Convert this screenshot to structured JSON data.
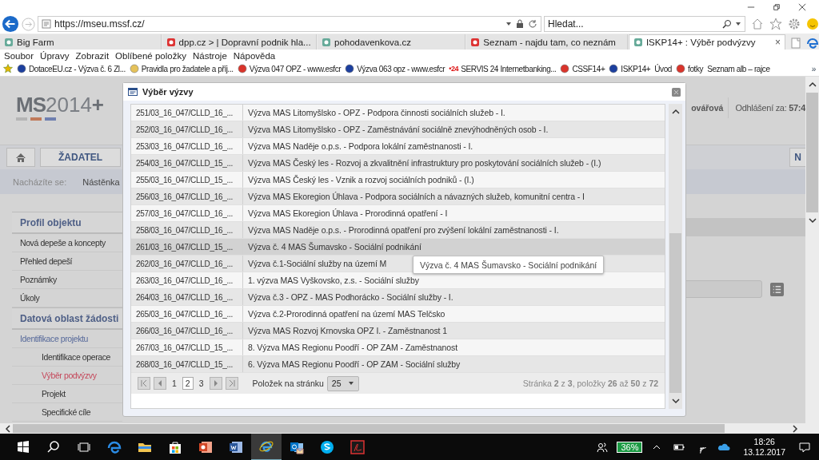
{
  "browser": {
    "url": "https://mseu.mssf.cz/",
    "search": {
      "placeholder": "Hledat..."
    },
    "tabs": [
      {
        "label": "Big Farm",
        "selected": false
      },
      {
        "label": "dpp.cz > | Dopravní podnik hla...",
        "selected": false
      },
      {
        "label": "pohodavenkova.cz",
        "selected": false
      },
      {
        "label": "Seznam - najdu tam, co neznám",
        "selected": false
      },
      {
        "label": "ISKP14+ : Výběr podvýzvy",
        "selected": true,
        "close": "×"
      }
    ],
    "menu": [
      "Soubor",
      "Úpravy",
      "Zobrazit",
      "Oblíbené položky",
      "Nástroje",
      "Nápověda"
    ],
    "favorites": [
      {
        "label": "DotaceEU.cz - Výzva č. 6 Zl..."
      },
      {
        "label": "Pravidla pro žadatele a příj..."
      },
      {
        "label": "Výzva 047 OPZ - www.esfcr"
      },
      {
        "label": "Výzva 063 opz - www.esfcr"
      },
      {
        "label": "SERVIS 24 Internetbanking...",
        "badge": "•24"
      },
      {
        "label": "CSSF14+"
      },
      {
        "label": "ISKP14+"
      },
      {
        "label": "Úvod",
        "kind": "text"
      },
      {
        "label": "fotky"
      },
      {
        "label": "Seznam alb – rajce",
        "kind": "text"
      }
    ],
    "more": "»"
  },
  "page": {
    "logo": {
      "bold": "MS",
      "rest": "2014",
      "plus": "+"
    },
    "user": "ovářová",
    "logout": "Odhlášení za: **57:4**",
    "nav": {
      "role": "ŽADATEL",
      "right": "N"
    },
    "breadcrumb": {
      "label": "Nacházíte se:",
      "current": "Nástěnka"
    },
    "sidebar": [
      {
        "title": "Profil objektu",
        "items": [
          {
            "label": "Nová depeše a koncepty",
            "selected": false
          },
          {
            "label": "Přehled depeší",
            "selected": false
          },
          {
            "label": "Poznámky",
            "selected": false
          },
          {
            "label": "Úkoly",
            "selected": false
          }
        ]
      },
      {
        "title": "Datová oblast žádosti",
        "items": [
          {
            "label": "Identifikace projektu",
            "selected": false,
            "expanded": true,
            "children": [
              {
                "label": "Identifikace operace",
                "selected": false
              },
              {
                "label": "Výběr podvýzvy",
                "selected": true
              },
              {
                "label": "Projekt",
                "selected": false
              },
              {
                "label": "Specifické cíle",
                "selected": false
              }
            ]
          }
        ]
      }
    ]
  },
  "dialog": {
    "title": "Výběr výzvy",
    "rows": [
      {
        "code": "251/03_16_047/CLLD_16_...",
        "name": "Výzva MAS Litomyšlsko - OPZ - Podpora činnosti sociálních služeb - I.",
        "hovered": false
      },
      {
        "code": "252/03_16_047/CLLD_16_...",
        "name": "Výzva MAS Litomyšlsko - OPZ - Zaměstnávání sociálně znevýhodněných osob - I.",
        "hovered": false
      },
      {
        "code": "253/03_16_047/CLLD_16_...",
        "name": "Výzva MAS Naděje o.p.s. - Podpora lokální zaměstnanosti - I.",
        "hovered": false
      },
      {
        "code": "254/03_16_047/CLLD_15_...",
        "name": "Výzva MAS Český les - Rozvoj a zkvalitnění infrastruktury pro poskytování sociálních služeb - (I.)",
        "hovered": false
      },
      {
        "code": "255/03_16_047/CLLD_15_...",
        "name": "Výzva MAS Český les - Vznik a rozvoj sociálních podniků - (I.)",
        "hovered": false
      },
      {
        "code": "256/03_16_047/CLLD_16_...",
        "name": "Výzva MAS Ekoregion Úhlava - Podpora sociálních a návazných služeb, komunitní centra - I",
        "hovered": false
      },
      {
        "code": "257/03_16_047/CLLD_16_...",
        "name": "Výzva MAS Ekoregion Úhlava - Prorodinná opatření - I",
        "hovered": false
      },
      {
        "code": "258/03_16_047/CLLD_16_...",
        "name": "Výzva MAS Naděje o.p.s. - Prorodinná opatření pro zvýšení lokální zaměstnanosti - I.",
        "hovered": false
      },
      {
        "code": "261/03_16_047/CLLD_15_...",
        "name": "Výzva č. 4 MAS Šumavsko - Sociální podnikání",
        "hovered": true
      },
      {
        "code": "262/03_16_047/CLLD_16_...",
        "name": "Výzva č.1-Sociální služby na území M",
        "hovered": false
      },
      {
        "code": "263/03_16_047/CLLD_16_...",
        "name": "1. výzva MAS Vyškovsko, z.s. - Sociální služby",
        "hovered": false
      },
      {
        "code": "264/03_16_047/CLLD_16_...",
        "name": "Výzva č.3 - OPZ - MAS Podhorácko - Sociální služby - I.",
        "hovered": false
      },
      {
        "code": "265/03_16_047/CLLD_16_...",
        "name": "Výzva č.2-Prorodinná opatření na území MAS Telčsko",
        "hovered": false
      },
      {
        "code": "266/03_16_047/CLLD_16_...",
        "name": "Výzva MAS Rozvoj Krnovska OPZ I. - Zaměstnanost 1",
        "hovered": false
      },
      {
        "code": "267/03_16_047/CLLD_15_...",
        "name": "8. Výzva MAS Regionu Poodří - OP ZAM - Zaměstnanost",
        "hovered": false
      },
      {
        "code": "268/03_16_047/CLLD_15_...",
        "name": "6. Výzva MAS Regionu Poodří - OP ZAM - Sociální služby",
        "hovered": false
      }
    ],
    "tooltip": "Výzva č. 4 MAS Šumavsko - Sociální podnikání",
    "pager": {
      "pages": [
        {
          "label": "1",
          "selected": false
        },
        {
          "label": "2",
          "selected": true
        },
        {
          "label": "3",
          "selected": false
        }
      ],
      "per_page_label": "Položek na stránku",
      "per_page": "25",
      "info": "Stránka **2** z **3**, položky **26** až **50** z **72**"
    }
  },
  "taskbar": {
    "battery": "36%",
    "time": "18:26",
    "date": "13.12.2017"
  }
}
